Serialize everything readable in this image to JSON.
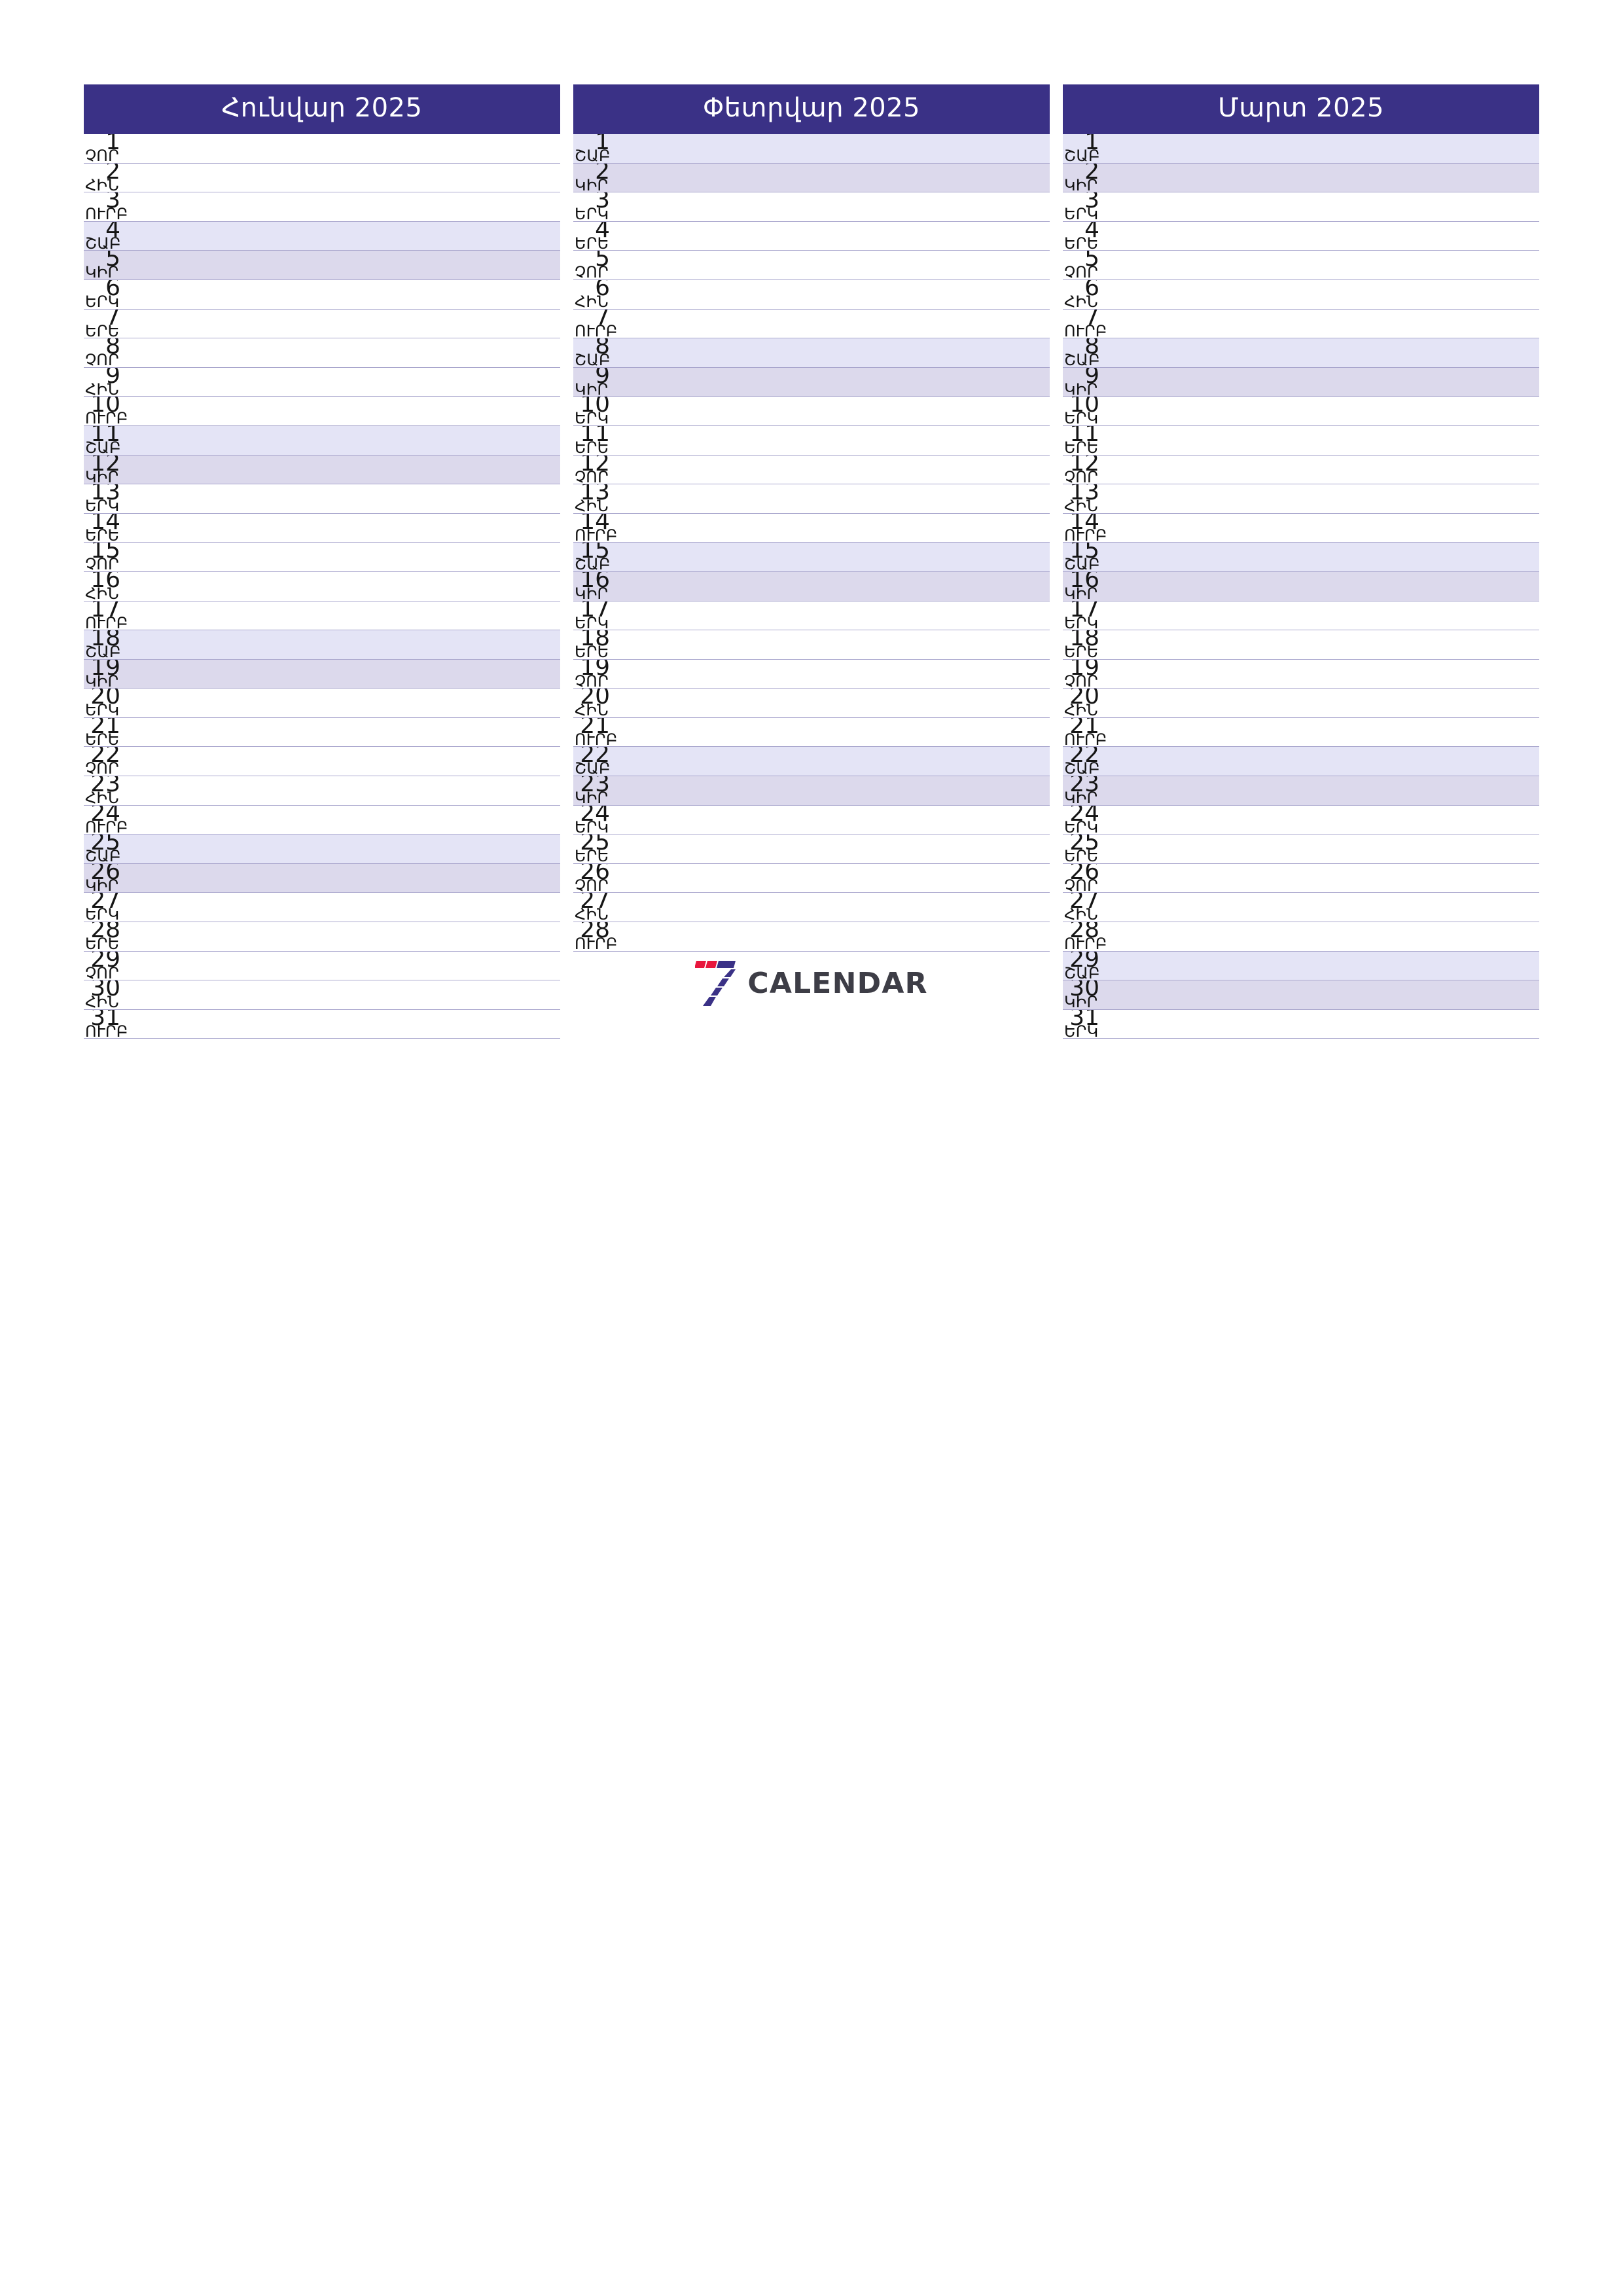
{
  "page": {
    "title": "Հունվար – Մարտ 2025 տարեկան պլանավորիչ",
    "year": "2025",
    "accent_color": "#3a3186",
    "saturday_color": "#e4e4f6",
    "sunday_color": "#dcd9ec",
    "rule_color": "#a9a6cd",
    "logo_red": "#e8173d",
    "logo_indigo": "#3a3186",
    "logo_word_color": "#3d3d46"
  },
  "brand": {
    "mark_name": "seven-calendar-logo",
    "word": "CALENDAR"
  },
  "weekday_names": {
    "mon": "ԵՐԿ",
    "tue": "ԵՐԵ",
    "wed": "ՉՈՐ",
    "thu": "ՀԻՆ",
    "fri": "ՈՒՐԲ",
    "sat": "ՇԱԲ",
    "sun": "ԿԻՐ"
  },
  "months": [
    {
      "name": "Հունվար 2025",
      "month_label": "Հունվար",
      "days": [
        {
          "n": "1",
          "wd": "ՉՈՐ",
          "type": "weekday"
        },
        {
          "n": "2",
          "wd": "ՀԻՆ",
          "type": "weekday"
        },
        {
          "n": "3",
          "wd": "ՈՒՐԲ",
          "type": "weekday"
        },
        {
          "n": "4",
          "wd": "ՇԱԲ",
          "type": "sat"
        },
        {
          "n": "5",
          "wd": "ԿԻՐ",
          "type": "sun"
        },
        {
          "n": "6",
          "wd": "ԵՐԿ",
          "type": "weekday"
        },
        {
          "n": "7",
          "wd": "ԵՐԵ",
          "type": "weekday"
        },
        {
          "n": "8",
          "wd": "ՉՈՐ",
          "type": "weekday"
        },
        {
          "n": "9",
          "wd": "ՀԻՆ",
          "type": "weekday"
        },
        {
          "n": "10",
          "wd": "ՈՒՐԲ",
          "type": "weekday"
        },
        {
          "n": "11",
          "wd": "ՇԱԲ",
          "type": "sat"
        },
        {
          "n": "12",
          "wd": "ԿԻՐ",
          "type": "sun"
        },
        {
          "n": "13",
          "wd": "ԵՐԿ",
          "type": "weekday"
        },
        {
          "n": "14",
          "wd": "ԵՐԵ",
          "type": "weekday"
        },
        {
          "n": "15",
          "wd": "ՉՈՐ",
          "type": "weekday"
        },
        {
          "n": "16",
          "wd": "ՀԻՆ",
          "type": "weekday"
        },
        {
          "n": "17",
          "wd": "ՈՒՐԲ",
          "type": "weekday"
        },
        {
          "n": "18",
          "wd": "ՇԱԲ",
          "type": "sat"
        },
        {
          "n": "19",
          "wd": "ԿԻՐ",
          "type": "sun"
        },
        {
          "n": "20",
          "wd": "ԵՐԿ",
          "type": "weekday"
        },
        {
          "n": "21",
          "wd": "ԵՐԵ",
          "type": "weekday"
        },
        {
          "n": "22",
          "wd": "ՉՈՐ",
          "type": "weekday"
        },
        {
          "n": "23",
          "wd": "ՀԻՆ",
          "type": "weekday"
        },
        {
          "n": "24",
          "wd": "ՈՒՐԲ",
          "type": "weekday"
        },
        {
          "n": "25",
          "wd": "ՇԱԲ",
          "type": "sat"
        },
        {
          "n": "26",
          "wd": "ԿԻՐ",
          "type": "sun"
        },
        {
          "n": "27",
          "wd": "ԵՐԿ",
          "type": "weekday"
        },
        {
          "n": "28",
          "wd": "ԵՐԵ",
          "type": "weekday"
        },
        {
          "n": "29",
          "wd": "ՉՈՐ",
          "type": "weekday"
        },
        {
          "n": "30",
          "wd": "ՀԻՆ",
          "type": "weekday"
        },
        {
          "n": "31",
          "wd": "ՈՒՐԲ",
          "type": "weekday"
        }
      ]
    },
    {
      "name": "Փետրվար 2025",
      "month_label": "Փետրվար",
      "days": [
        {
          "n": "1",
          "wd": "ՇԱԲ",
          "type": "sat"
        },
        {
          "n": "2",
          "wd": "ԿԻՐ",
          "type": "sun"
        },
        {
          "n": "3",
          "wd": "ԵՐԿ",
          "type": "weekday"
        },
        {
          "n": "4",
          "wd": "ԵՐԵ",
          "type": "weekday"
        },
        {
          "n": "5",
          "wd": "ՉՈՐ",
          "type": "weekday"
        },
        {
          "n": "6",
          "wd": "ՀԻՆ",
          "type": "weekday"
        },
        {
          "n": "7",
          "wd": "ՈՒՐԲ",
          "type": "weekday"
        },
        {
          "n": "8",
          "wd": "ՇԱԲ",
          "type": "sat"
        },
        {
          "n": "9",
          "wd": "ԿԻՐ",
          "type": "sun"
        },
        {
          "n": "10",
          "wd": "ԵՐԿ",
          "type": "weekday"
        },
        {
          "n": "11",
          "wd": "ԵՐԵ",
          "type": "weekday"
        },
        {
          "n": "12",
          "wd": "ՉՈՐ",
          "type": "weekday"
        },
        {
          "n": "13",
          "wd": "ՀԻՆ",
          "type": "weekday"
        },
        {
          "n": "14",
          "wd": "ՈՒՐԲ",
          "type": "weekday"
        },
        {
          "n": "15",
          "wd": "ՇԱԲ",
          "type": "sat"
        },
        {
          "n": "16",
          "wd": "ԿԻՐ",
          "type": "sun"
        },
        {
          "n": "17",
          "wd": "ԵՐԿ",
          "type": "weekday"
        },
        {
          "n": "18",
          "wd": "ԵՐԵ",
          "type": "weekday"
        },
        {
          "n": "19",
          "wd": "ՉՈՐ",
          "type": "weekday"
        },
        {
          "n": "20",
          "wd": "ՀԻՆ",
          "type": "weekday"
        },
        {
          "n": "21",
          "wd": "ՈՒՐԲ",
          "type": "weekday"
        },
        {
          "n": "22",
          "wd": "ՇԱԲ",
          "type": "sat"
        },
        {
          "n": "23",
          "wd": "ԿԻՐ",
          "type": "sun"
        },
        {
          "n": "24",
          "wd": "ԵՐԿ",
          "type": "weekday"
        },
        {
          "n": "25",
          "wd": "ԵՐԵ",
          "type": "weekday"
        },
        {
          "n": "26",
          "wd": "ՉՈՐ",
          "type": "weekday"
        },
        {
          "n": "27",
          "wd": "ՀԻՆ",
          "type": "weekday"
        },
        {
          "n": "28",
          "wd": "ՈՒՐԲ",
          "type": "weekday"
        }
      ]
    },
    {
      "name": "Մարտ 2025",
      "month_label": "Մարտ",
      "days": [
        {
          "n": "1",
          "wd": "ՇԱԲ",
          "type": "sat"
        },
        {
          "n": "2",
          "wd": "ԿԻՐ",
          "type": "sun"
        },
        {
          "n": "3",
          "wd": "ԵՐԿ",
          "type": "weekday"
        },
        {
          "n": "4",
          "wd": "ԵՐԵ",
          "type": "weekday"
        },
        {
          "n": "5",
          "wd": "ՉՈՐ",
          "type": "weekday"
        },
        {
          "n": "6",
          "wd": "ՀԻՆ",
          "type": "weekday"
        },
        {
          "n": "7",
          "wd": "ՈՒՐԲ",
          "type": "weekday"
        },
        {
          "n": "8",
          "wd": "ՇԱԲ",
          "type": "sat"
        },
        {
          "n": "9",
          "wd": "ԿԻՐ",
          "type": "sun"
        },
        {
          "n": "10",
          "wd": "ԵՐԿ",
          "type": "weekday"
        },
        {
          "n": "11",
          "wd": "ԵՐԵ",
          "type": "weekday"
        },
        {
          "n": "12",
          "wd": "ՉՈՐ",
          "type": "weekday"
        },
        {
          "n": "13",
          "wd": "ՀԻՆ",
          "type": "weekday"
        },
        {
          "n": "14",
          "wd": "ՈՒՐԲ",
          "type": "weekday"
        },
        {
          "n": "15",
          "wd": "ՇԱԲ",
          "type": "sat"
        },
        {
          "n": "16",
          "wd": "ԿԻՐ",
          "type": "sun"
        },
        {
          "n": "17",
          "wd": "ԵՐԿ",
          "type": "weekday"
        },
        {
          "n": "18",
          "wd": "ԵՐԵ",
          "type": "weekday"
        },
        {
          "n": "19",
          "wd": "ՉՈՐ",
          "type": "weekday"
        },
        {
          "n": "20",
          "wd": "ՀԻՆ",
          "type": "weekday"
        },
        {
          "n": "21",
          "wd": "ՈՒՐԲ",
          "type": "weekday"
        },
        {
          "n": "22",
          "wd": "ՇԱԲ",
          "type": "sat"
        },
        {
          "n": "23",
          "wd": "ԿԻՐ",
          "type": "sun"
        },
        {
          "n": "24",
          "wd": "ԵՐԿ",
          "type": "weekday"
        },
        {
          "n": "25",
          "wd": "ԵՐԵ",
          "type": "weekday"
        },
        {
          "n": "26",
          "wd": "ՉՈՐ",
          "type": "weekday"
        },
        {
          "n": "27",
          "wd": "ՀԻՆ",
          "type": "weekday"
        },
        {
          "n": "28",
          "wd": "ՈՒՐԲ",
          "type": "weekday"
        },
        {
          "n": "29",
          "wd": "ՇԱԲ",
          "type": "sat"
        },
        {
          "n": "30",
          "wd": "ԿԻՐ",
          "type": "sun"
        },
        {
          "n": "31",
          "wd": "ԵՐԿ",
          "type": "weekday"
        }
      ]
    }
  ]
}
